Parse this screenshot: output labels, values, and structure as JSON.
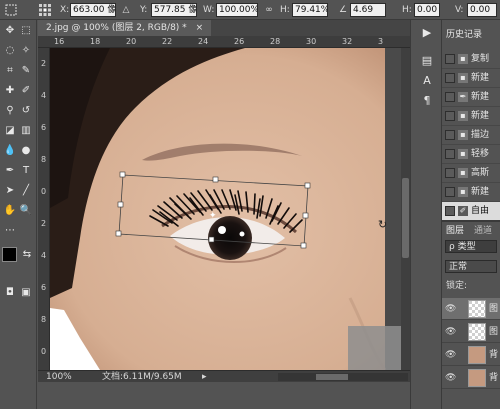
{
  "options_bar": {
    "x_label": "X:",
    "x_value": "663.00 像素",
    "delta_icon": "triangle-icon",
    "y_label": "Y:",
    "y_value": "577.85 像素",
    "w_label": "W:",
    "w_value": "100.00%",
    "link_icon": "link-icon",
    "h_label": "H:",
    "h_value": "79.41%",
    "angle_icon": "angle-icon",
    "angle_value": "4.69",
    "hskew_label": "H:",
    "hskew_value": "0.00",
    "vskew_label": "V:",
    "vskew_value": "0.00"
  },
  "document": {
    "tab_title": "2.jpg @ 100% (图层 2, RGB/8) *",
    "close_icon": "close-icon",
    "ruler_h_ticks": [
      "16",
      "18",
      "20",
      "22",
      "24",
      "26",
      "28",
      "30",
      "32",
      "3"
    ],
    "ruler_v_ticks": [
      "2",
      "4",
      "6",
      "8",
      "0",
      "2",
      "4",
      "6",
      "8",
      "0"
    ]
  },
  "status": {
    "zoom": "100%",
    "doc_info": "文档:6.11M/9.65M"
  },
  "history": {
    "title": "历史记录",
    "items": [
      {
        "label": "复制",
        "icon": "doc-icon"
      },
      {
        "label": "新建",
        "icon": "doc-icon"
      },
      {
        "label": "新建",
        "icon": "pen-icon"
      },
      {
        "label": "新建",
        "icon": "doc-icon"
      },
      {
        "label": "描边",
        "icon": "doc-icon"
      },
      {
        "label": "轻移",
        "icon": "doc-icon"
      },
      {
        "label": "高斯",
        "icon": "doc-icon"
      },
      {
        "label": "新建",
        "icon": "doc-icon"
      },
      {
        "label": "自由",
        "icon": "brush-icon"
      }
    ]
  },
  "layers": {
    "tab1": "图层",
    "tab2": "通道",
    "filter_label": "ρ 类型",
    "blend_mode": "正常",
    "lock_label": "锁定:",
    "rows": [
      {
        "name": "图",
        "thumb": "transparent"
      },
      {
        "name": "图",
        "thumb": "transparent"
      },
      {
        "name": "背",
        "thumb": "face"
      },
      {
        "name": "背",
        "thumb": "face"
      }
    ]
  },
  "colors": {
    "ui_bg": "#535353",
    "ui_dark": "#3d3d3d",
    "skin": "#d9b49a",
    "hair": "#2a1d17"
  }
}
